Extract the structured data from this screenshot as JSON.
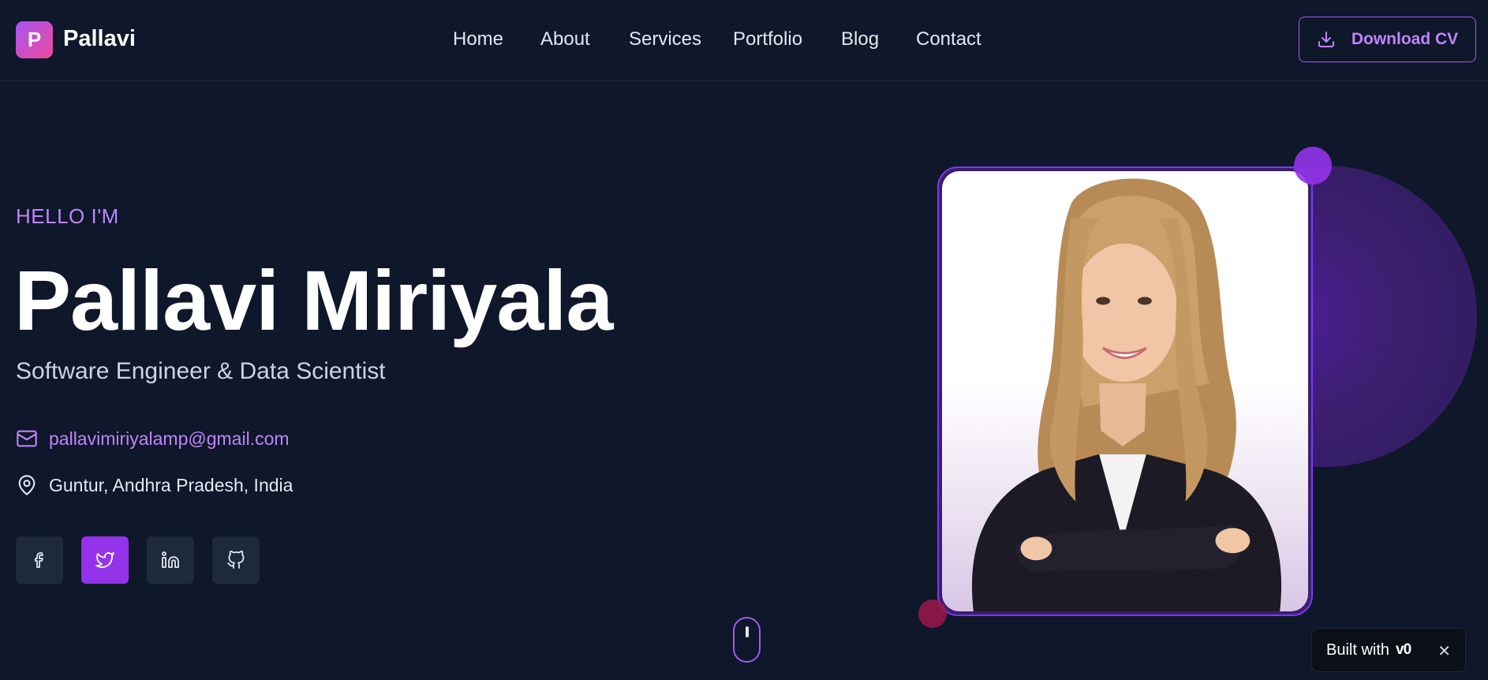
{
  "header": {
    "logo_letter": "P",
    "logo_name": "Pallavi",
    "nav": [
      {
        "label": "Home"
      },
      {
        "label": "About"
      },
      {
        "label": "Services"
      },
      {
        "label": "Portfolio"
      },
      {
        "label": "Blog"
      },
      {
        "label": "Contact"
      }
    ],
    "cv_button_label": "Download CV",
    "cv_button_icon": "download-icon"
  },
  "hero": {
    "greeting": "HELLO I'M",
    "name": "Pallavi Miriyala",
    "title": "Software Engineer & Data Scientist",
    "email": "pallavimiriyalamp@gmail.com",
    "location": "Guntur, Andhra Pradesh, India",
    "socials": [
      {
        "icon": "facebook-icon",
        "active": false
      },
      {
        "icon": "twitter-icon",
        "active": true
      },
      {
        "icon": "linkedin-icon",
        "active": false
      },
      {
        "icon": "github-icon",
        "active": false
      }
    ]
  },
  "badge": {
    "prefix": "Built with",
    "logo_text": "v0",
    "close": "✕"
  },
  "colors": {
    "background": "#0f172a",
    "accent": "#a855f7",
    "accent_strong": "#9333ea",
    "accent_text": "#c084fc",
    "social_bg": "#1e293b"
  }
}
